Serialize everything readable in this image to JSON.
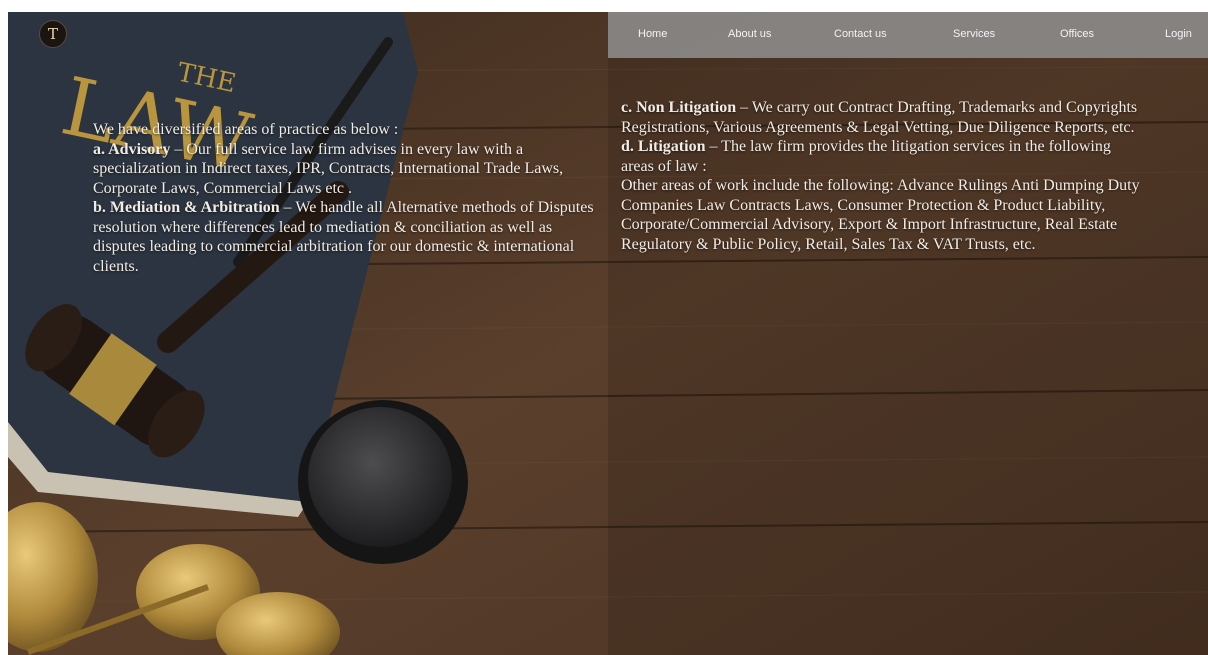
{
  "nav": {
    "home": "Home",
    "about": "About us",
    "contact": "Contact us",
    "services": "Services",
    "offices": "Offices",
    "login": "Login"
  },
  "logo": {
    "glyph": "T"
  },
  "book": {
    "title_small": "THE",
    "title_large": "LAW"
  },
  "content": {
    "intro": "We have diversified areas of practice as below :",
    "advisory_head": "a. Advisory",
    "advisory_body": " – Our full service law firm advises in every law with a specialization in Indirect taxes, IPR, Contracts, International Trade Laws, Corporate Laws, Commercial Laws etc .",
    "mediation_head": "b. Mediation & Arbitration",
    "mediation_body": " – We handle all Alternative methods of Disputes resolution where differences lead to mediation & conciliation as well as disputes leading to commercial arbitration for our domestic & international clients.",
    "nonlit_head": "c. Non Litigation",
    "nonlit_body": " – We carry out Contract Drafting, Trademarks and Copyrights Registrations, Various Agreements & Legal Vetting, Due Diligence Reports, etc.",
    "lit_head": "d. Litigation",
    "lit_body": " – The law firm provides the litigation services in the following areas of law :",
    "other": "Other areas of work include the following: Advance Rulings Anti Dumping Duty Companies Law Contracts Laws, Consumer Protection & Product Liability, Corporate/Commercial Advisory, Export & Import Infrastructure, Real Estate Regulatory & Public Policy, Retail, Sales Tax & VAT Trusts, etc."
  }
}
